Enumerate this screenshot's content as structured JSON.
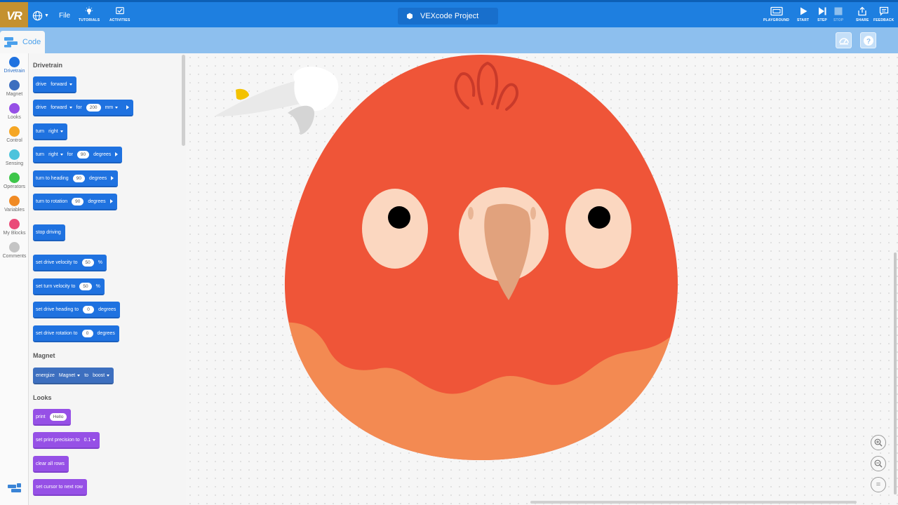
{
  "topbar": {
    "logo": "VR",
    "file_label": "File",
    "tutorials_label": "TUTORIALS",
    "activities_label": "ACTIVITIES",
    "project_title": "VEXcode Project",
    "playground_label": "PLAYGROUND",
    "start_label": "START",
    "step_label": "STEP",
    "stop_label": "STOP",
    "share_label": "SHARE",
    "feedback_label": "FEEDBACK"
  },
  "subbar": {
    "code_tab": "Code"
  },
  "categories": [
    {
      "label": "Drivetrain",
      "color": "#1f72e0"
    },
    {
      "label": "Magnet",
      "color": "#3d6fbf"
    },
    {
      "label": "Looks",
      "color": "#9650e6"
    },
    {
      "label": "Control",
      "color": "#f5a623"
    },
    {
      "label": "Sensing",
      "color": "#4cc3dc"
    },
    {
      "label": "Operators",
      "color": "#3ec64a"
    },
    {
      "label": "Variables",
      "color": "#f08a24"
    },
    {
      "label": "My Blocks",
      "color": "#ea4a78"
    },
    {
      "label": "Comments",
      "color": "#c4c4c4"
    }
  ],
  "palette": {
    "drivetrain_title": "Drivetrain",
    "magnet_title": "Magnet",
    "looks_title": "Looks",
    "blocks": {
      "drive": {
        "verb": "drive",
        "dir": "forward"
      },
      "drive_for": {
        "verb": "drive",
        "dir": "forward",
        "for": "for",
        "value": "200",
        "unit": "mm"
      },
      "turn": {
        "verb": "turn",
        "dir": "right"
      },
      "turn_for": {
        "verb": "turn",
        "dir": "right",
        "for": "for",
        "value": "90",
        "unit": "degrees"
      },
      "turn_heading": {
        "text": "turn to heading",
        "value": "90",
        "unit": "degrees"
      },
      "turn_rotation": {
        "text": "turn to rotation",
        "value": "90",
        "unit": "degrees"
      },
      "stop_driving": {
        "text": "stop driving"
      },
      "drive_velocity": {
        "text": "set drive velocity to",
        "value": "50",
        "unit": "%"
      },
      "turn_velocity": {
        "text": "set turn velocity to",
        "value": "50",
        "unit": "%"
      },
      "drive_heading": {
        "text": "set drive heading to",
        "value": "0",
        "unit": "degrees"
      },
      "drive_rotation": {
        "text": "set drive rotation to",
        "value": "0",
        "unit": "degrees"
      },
      "energize": {
        "text": "energize",
        "device": "Magnet",
        "to": "to",
        "mode": "boost"
      },
      "print": {
        "text": "print",
        "value": "Hello"
      },
      "print_precision": {
        "text": "set print precision to",
        "value": "0.1"
      },
      "clear_rows": {
        "text": "clear all rows"
      },
      "cursor_next": {
        "text": "set cursor to next row"
      }
    }
  },
  "zoom": {
    "reset_label": "="
  }
}
